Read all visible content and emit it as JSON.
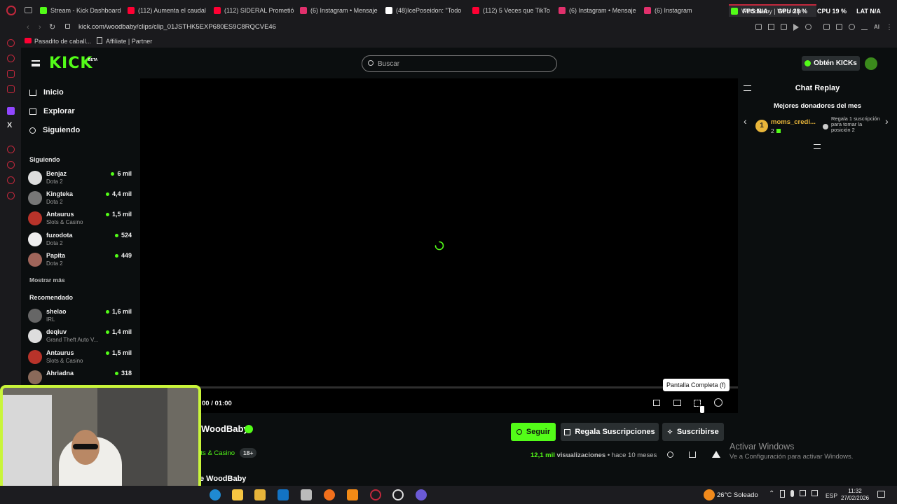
{
  "browser": {
    "tabs": [
      {
        "label": "Stream - Kick Dashboard",
        "icon": "kick-icon",
        "color": "#53fc18"
      },
      {
        "label": "(112) Aumenta el caudal",
        "icon": "youtube-icon",
        "color": "#ff0033"
      },
      {
        "label": "(112) SIDERAL Prometió",
        "icon": "youtube-icon",
        "color": "#ff0033"
      },
      {
        "label": "(6) Instagram • Mensaje",
        "icon": "instagram-icon",
        "color": "#e1306c"
      },
      {
        "label": "(48)IcePoseidon: \"Todo",
        "icon": "tiktok-icon",
        "color": "#ffffff"
      },
      {
        "label": "(112) 5 Veces que TikTo",
        "icon": "youtube-icon",
        "color": "#ff0033"
      },
      {
        "label": "(6) Instagram • Mensaje",
        "icon": "instagram-icon",
        "color": "#e1306c"
      },
      {
        "label": "(6) Instagram",
        "icon": "instagram-icon",
        "color": "#e1306c"
      },
      {
        "label": "WoodBaby | Web clip",
        "icon": "kick-icon",
        "color": "#53fc18"
      }
    ],
    "overlay_stats": {
      "fps": "FPS N/A",
      "gpu": "GPU 28 %",
      "cpu": "CPU 19 %",
      "lat": "LAT N/A"
    },
    "url": "kick.com/woodbaby/clips/clip_01JSTHK5EXP680ES9C8RQCVE46",
    "bookmarks": [
      "Pasadito de caball...",
      "Affiliate | Partner"
    ]
  },
  "kick": {
    "logo": "KICK",
    "logo_badge": "BETA",
    "search_placeholder": "Buscar",
    "get_kicks": "Obtén KICKs",
    "nav": [
      {
        "label": "Inicio",
        "icon": "home-icon"
      },
      {
        "label": "Explorar",
        "icon": "explore-icon"
      },
      {
        "label": "Siguiendo",
        "icon": "heart-icon"
      }
    ],
    "following_title": "Siguiendo",
    "following": [
      {
        "name": "Benjaz",
        "game": "Dota 2",
        "viewers": "6 mil"
      },
      {
        "name": "Kingteka",
        "game": "Dota 2",
        "viewers": "4,4 mil"
      },
      {
        "name": "Antaurus",
        "game": "Slots & Casino",
        "viewers": "1,5 mil"
      },
      {
        "name": "fuzodota",
        "game": "Dota 2",
        "viewers": "524"
      },
      {
        "name": "Papita",
        "game": "Dota 2",
        "viewers": "449"
      }
    ],
    "show_more": "Mostrar más",
    "recommended_title": "Recomendado",
    "recommended": [
      {
        "name": "shelao",
        "game": "IRL",
        "viewers": "1,6 mil"
      },
      {
        "name": "deqiuv",
        "game": "Grand Theft Auto V...",
        "viewers": "1,4 mil"
      },
      {
        "name": "Antaurus",
        "game": "Slots & Casino",
        "viewers": "1,5 mil"
      },
      {
        "name": "Ahriadna",
        "game": "",
        "viewers": "318"
      }
    ],
    "player": {
      "time": "00 / 01:00",
      "tooltip": "Pantalla Completa (f)",
      "progress": 0.0
    },
    "channel": {
      "name": "WoodBaby",
      "category": "Slots & Casino",
      "age": "18+",
      "clip_title": "e WoodBaby",
      "follow": "Seguir",
      "gift_subs": "Regala Suscripciones",
      "subscribe": "Suscribirse",
      "views_num": "12,1 mil",
      "views_label": "visualizaciones",
      "ago": "• hace 10 meses"
    },
    "chat": {
      "title": "Chat Replay",
      "top_donors_title": "Mejores donadores del mes",
      "donor_rank": "1",
      "donor_name": "moms_credi...",
      "donor_count": "2",
      "gift_prompt": "Regala 1 suscripción para tomar la posición 2"
    }
  },
  "windows": {
    "activate_title": "Activar Windows",
    "activate_sub": "Ve a Configuración para activar Windows.",
    "weather": "26°C Soleado",
    "lang": "ESP",
    "time": "11:32",
    "date": "27/02/2026"
  },
  "colors": {
    "kick_green": "#53fc18",
    "dark_bg": "#0b0e0f",
    "webcam_border": "#c9f53a"
  }
}
